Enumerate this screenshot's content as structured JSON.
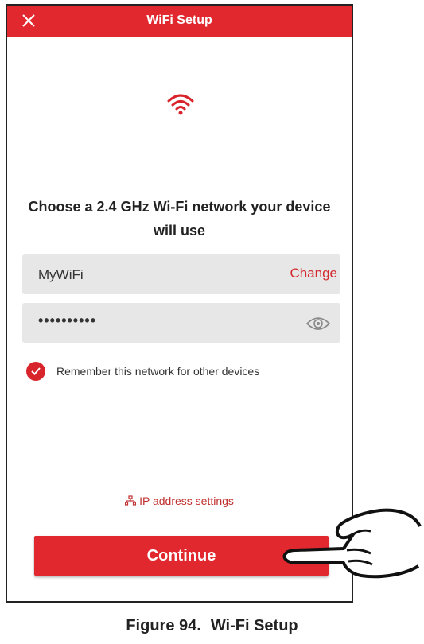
{
  "header": {
    "title": "WiFi Setup",
    "close_icon": "close-icon"
  },
  "main": {
    "wifi_icon": "wifi-icon",
    "heading": "Choose a 2.4 GHz Wi-Fi network your device will use",
    "ssid": {
      "value": "MyWiFi",
      "change_label": "Change"
    },
    "password": {
      "masked_value": "••••••••••",
      "eye_icon": "eye-icon"
    },
    "remember": {
      "label": "Remember this network for other devices",
      "checked": true
    },
    "ip_link": {
      "label": "IP address settings",
      "icon": "network-icon"
    },
    "continue_label": "Continue"
  },
  "caption": {
    "figure": "Figure 94.",
    "title": "Wi-Fi Setup"
  },
  "colors": {
    "accent": "#e0282e",
    "field_bg": "#e7e7e7"
  }
}
